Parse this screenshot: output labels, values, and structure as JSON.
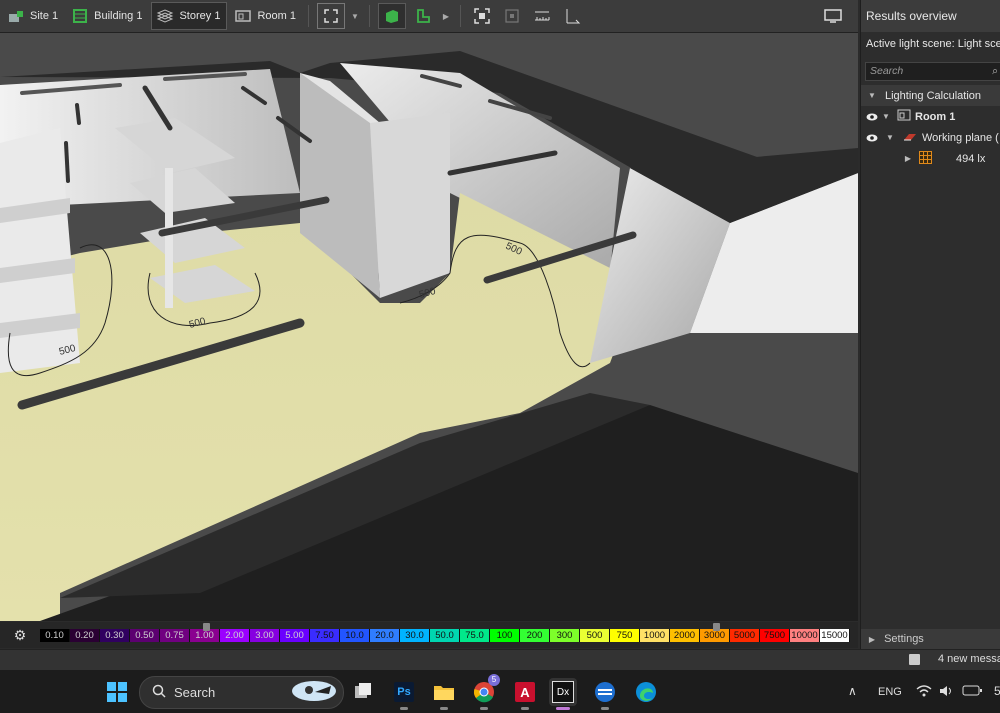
{
  "toolbar": {
    "breadcrumbs": [
      {
        "label": "Site 1",
        "icon": "site-icon"
      },
      {
        "label": "Building 1",
        "icon": "building-icon"
      },
      {
        "label": "Storey 1",
        "icon": "storey-icon",
        "active": true
      },
      {
        "label": "Room 1",
        "icon": "room-icon"
      }
    ]
  },
  "viewport": {
    "contour_labels": [
      "500",
      "500",
      "500",
      "500"
    ]
  },
  "legend": {
    "values": [
      "0.10",
      "0.20",
      "0.30",
      "0.50",
      "0.75",
      "1.00",
      "2.00",
      "3.00",
      "5.00",
      "7.50",
      "10.0",
      "20.0",
      "30.0",
      "50.0",
      "75.0",
      "100",
      "200",
      "300",
      "500",
      "750",
      "1000",
      "2000",
      "3000",
      "5000",
      "7500",
      "10000",
      "15000"
    ],
    "colors": [
      "#000000",
      "#2a0033",
      "#300060",
      "#5c0070",
      "#700080",
      "#8a0090",
      "#9b00ff",
      "#8600e0",
      "#6a00ff",
      "#3a2cff",
      "#2255ff",
      "#2f7dff",
      "#00b4ff",
      "#00d6b0",
      "#00e88a",
      "#00ff00",
      "#33ff33",
      "#7dff2a",
      "#eaff33",
      "#ffff00",
      "#ffe066",
      "#ffc000",
      "#ff9a00",
      "#ff2a00",
      "#ff0000",
      "#ff8080",
      "#ffffff"
    ]
  },
  "right_panel": {
    "title": "Results overview",
    "active_scene": "Active light scene: Light scene",
    "search_placeholder": "Search",
    "tree": [
      {
        "label": "Lighting Calculation",
        "level": 0
      },
      {
        "label": "Room 1",
        "level": 1
      },
      {
        "label": "Working plane (",
        "level": 2
      },
      {
        "label": "494 lx",
        "level": 3
      }
    ],
    "settings_label": "Settings"
  },
  "status": {
    "messages": "4 new messa"
  },
  "taskbar": {
    "search_label": "Search",
    "chrome_badge": "5",
    "language": "ENG",
    "clock_partial": "5"
  }
}
